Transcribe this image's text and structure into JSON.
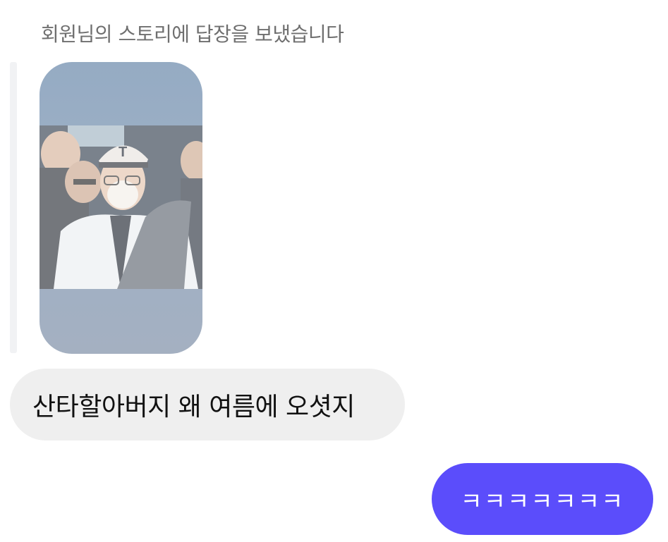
{
  "story_reply": {
    "caption": "회원님의 스토리에 답장을 보냈습니다",
    "story_preview": {
      "background_top": "#95abc3",
      "background_bottom": "#a4b0c1"
    }
  },
  "messages": [
    {
      "direction": "received",
      "text": "산타할아버지 왜 여름에 오셧지",
      "bubble_color": "#efefef"
    },
    {
      "direction": "sent",
      "text": "ㅋㅋㅋㅋㅋㅋㅋ",
      "bubble_color": "#5b4dfb"
    }
  ]
}
